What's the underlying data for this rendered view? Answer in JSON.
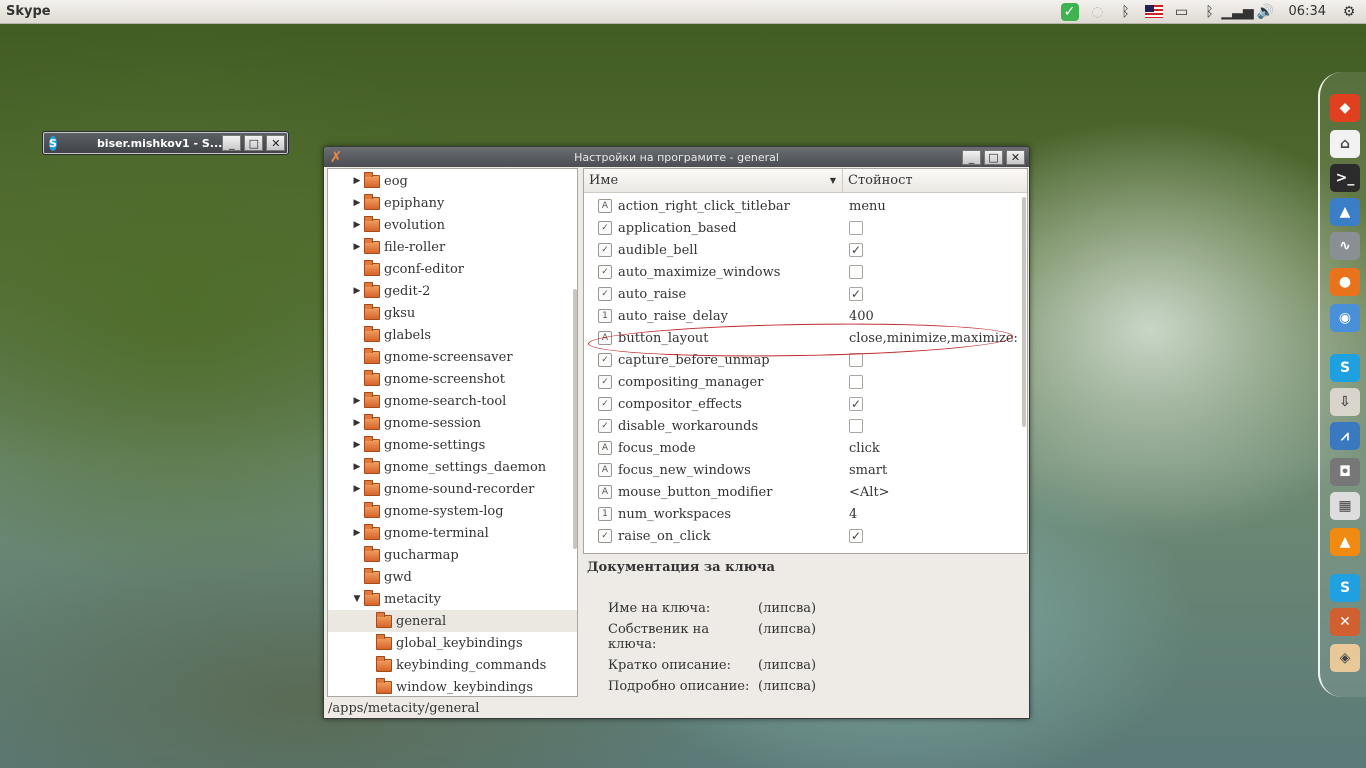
{
  "top_panel": {
    "app_name": "Skype",
    "clock": "06:34"
  },
  "mini_window": {
    "title": "biser.mishkov1 - S..."
  },
  "main_window": {
    "title": "Настройки на програмите - general"
  },
  "tree": {
    "items": [
      {
        "label": "eog",
        "expander": "▶",
        "level": 0
      },
      {
        "label": "epiphany",
        "expander": "▶",
        "level": 0
      },
      {
        "label": "evolution",
        "expander": "▶",
        "level": 0
      },
      {
        "label": "file-roller",
        "expander": "▶",
        "level": 0
      },
      {
        "label": "gconf-editor",
        "expander": "",
        "level": 0
      },
      {
        "label": "gedit-2",
        "expander": "▶",
        "level": 0
      },
      {
        "label": "gksu",
        "expander": "",
        "level": 0
      },
      {
        "label": "glabels",
        "expander": "",
        "level": 0
      },
      {
        "label": "gnome-screensaver",
        "expander": "",
        "level": 0
      },
      {
        "label": "gnome-screenshot",
        "expander": "",
        "level": 0
      },
      {
        "label": "gnome-search-tool",
        "expander": "▶",
        "level": 0
      },
      {
        "label": "gnome-session",
        "expander": "▶",
        "level": 0
      },
      {
        "label": "gnome-settings",
        "expander": "▶",
        "level": 0
      },
      {
        "label": "gnome_settings_daemon",
        "expander": "▶",
        "level": 0
      },
      {
        "label": "gnome-sound-recorder",
        "expander": "▶",
        "level": 0
      },
      {
        "label": "gnome-system-log",
        "expander": "",
        "level": 0
      },
      {
        "label": "gnome-terminal",
        "expander": "▶",
        "level": 0
      },
      {
        "label": "gucharmap",
        "expander": "",
        "level": 0
      },
      {
        "label": "gwd",
        "expander": "",
        "level": 0
      },
      {
        "label": "metacity",
        "expander": "▼",
        "level": 0
      },
      {
        "label": "general",
        "expander": "",
        "level": 1,
        "selected": true
      },
      {
        "label": "global_keybindings",
        "expander": "",
        "level": 1
      },
      {
        "label": "keybinding_commands",
        "expander": "",
        "level": 1
      },
      {
        "label": "window_keybindings",
        "expander": "",
        "level": 1
      }
    ]
  },
  "keys": {
    "col_name": "Име",
    "col_value": "Стойност",
    "rows": [
      {
        "name": "action_right_click_titlebar",
        "type": "A",
        "kind": "text",
        "value": "menu"
      },
      {
        "name": "application_based",
        "type": "✓",
        "kind": "bool",
        "checked": false
      },
      {
        "name": "audible_bell",
        "type": "✓",
        "kind": "bool",
        "checked": true
      },
      {
        "name": "auto_maximize_windows",
        "type": "✓",
        "kind": "bool",
        "checked": false
      },
      {
        "name": "auto_raise",
        "type": "✓",
        "kind": "bool",
        "checked": true
      },
      {
        "name": "auto_raise_delay",
        "type": "1",
        "kind": "text",
        "value": "400"
      },
      {
        "name": "button_layout",
        "type": "A",
        "kind": "text",
        "value": "close,minimize,maximize:"
      },
      {
        "name": "capture_before_unmap",
        "type": "✓",
        "kind": "bool",
        "checked": false
      },
      {
        "name": "compositing_manager",
        "type": "✓",
        "kind": "bool",
        "checked": false
      },
      {
        "name": "compositor_effects",
        "type": "✓",
        "kind": "bool",
        "checked": true
      },
      {
        "name": "disable_workarounds",
        "type": "✓",
        "kind": "bool",
        "checked": false
      },
      {
        "name": "focus_mode",
        "type": "A",
        "kind": "text",
        "value": "click"
      },
      {
        "name": "focus_new_windows",
        "type": "A",
        "kind": "text",
        "value": "smart"
      },
      {
        "name": "mouse_button_modifier",
        "type": "A",
        "kind": "text",
        "value": "<Alt>"
      },
      {
        "name": "num_workspaces",
        "type": "1",
        "kind": "text",
        "value": "4"
      },
      {
        "name": "raise_on_click",
        "type": "✓",
        "kind": "bool",
        "checked": true
      }
    ]
  },
  "docs": {
    "heading": "Документация за ключа",
    "fields": [
      {
        "label": "Име на ключа:",
        "value": "(липсва)"
      },
      {
        "label": "Собственик на ключа:",
        "value": "(липсва)"
      },
      {
        "label": "Кратко описание:",
        "value": "(липсва)"
      },
      {
        "label": "Подробно описание:",
        "value": "(липсва)"
      }
    ]
  },
  "status": {
    "path": "/apps/metacity/general"
  },
  "dock": {
    "items": [
      {
        "icon": "ubuntu-one-icon",
        "glyph": "◆",
        "color": "#e04020"
      },
      {
        "icon": "home-folder-icon",
        "glyph": "⌂",
        "color": "#f2f2f2"
      },
      {
        "icon": "terminal-icon",
        "glyph": ">_",
        "color": "#2b2b2b"
      },
      {
        "icon": "arch-icon",
        "glyph": "▲",
        "color": "#3b7ec8"
      },
      {
        "icon": "system-monitor-icon",
        "glyph": "∿",
        "color": "#8a8f96"
      },
      {
        "icon": "firefox-icon",
        "glyph": "●",
        "color": "#e8731c"
      },
      {
        "icon": "chromium-icon",
        "glyph": "◉",
        "color": "#4a90d9"
      },
      {
        "icon": "skype-icon",
        "glyph": "S",
        "color": "#1fa0e0"
      },
      {
        "icon": "download-icon",
        "glyph": "⇩",
        "color": "#d9d4cc"
      },
      {
        "icon": "activity-monitor-icon",
        "glyph": "⩘",
        "color": "#3a78c0"
      },
      {
        "icon": "camera-icon",
        "glyph": "◘",
        "color": "#777"
      },
      {
        "icon": "calculator-icon",
        "glyph": "▦",
        "color": "#ddd"
      },
      {
        "icon": "vlc-icon",
        "glyph": "▲",
        "color": "#f08a10"
      },
      {
        "icon": "skype-icon-2",
        "glyph": "S",
        "color": "#1fa0e0"
      },
      {
        "icon": "tools-icon",
        "glyph": "✕",
        "color": "#d06030"
      },
      {
        "icon": "package-icon",
        "glyph": "◈",
        "color": "#e8c898"
      }
    ]
  }
}
